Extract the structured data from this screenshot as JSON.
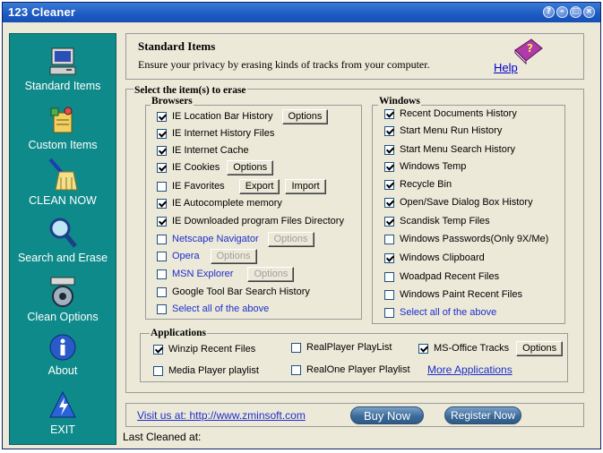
{
  "window": {
    "title": "123 Cleaner",
    "buttons": [
      "?",
      "–",
      "□",
      "×"
    ]
  },
  "sidebar": {
    "items": [
      {
        "label": "Standard Items",
        "icon": "computer-icon"
      },
      {
        "label": "Custom Items",
        "icon": "custom-items-icon"
      },
      {
        "label": "CLEAN NOW",
        "icon": "broom-icon"
      },
      {
        "label": "Search and  Erase",
        "icon": "magnifier-icon"
      },
      {
        "label": "Clean Options",
        "icon": "clean-options-icon"
      },
      {
        "label": "About",
        "icon": "info-icon"
      },
      {
        "label": "EXIT",
        "icon": "exit-icon"
      }
    ]
  },
  "header": {
    "title": "Standard Items",
    "description": "Ensure your privacy by erasing kinds of tracks from your computer.",
    "help": "Help"
  },
  "select_section": {
    "title": "Select the item(s) to erase"
  },
  "browsers": {
    "title": "Browsers",
    "items": [
      {
        "label": "IE Location Bar History",
        "checked": true,
        "buttons": [
          "Options"
        ]
      },
      {
        "label": "IE Internet History Files",
        "checked": true
      },
      {
        "label": "IE Internet Cache",
        "checked": true
      },
      {
        "label": "IE Cookies",
        "checked": true,
        "buttons": [
          "Options"
        ]
      },
      {
        "label": "IE Favorites",
        "checked": false,
        "buttons": [
          "Export",
          "Import"
        ]
      },
      {
        "label": "IE Autocomplete memory",
        "checked": true
      },
      {
        "label": "IE Downloaded program Files Directory",
        "checked": true
      },
      {
        "label": "Netscape Navigator",
        "checked": false,
        "buttons": [
          "Options"
        ]
      },
      {
        "label": "Opera",
        "checked": false,
        "buttons": [
          "Options"
        ]
      },
      {
        "label": "MSN Explorer",
        "checked": false,
        "buttons": [
          "Options"
        ]
      },
      {
        "label": "Google Tool Bar Search History",
        "checked": false
      },
      {
        "label": "Select all of the above",
        "checked": false
      }
    ]
  },
  "windows": {
    "title": "Windows",
    "items": [
      {
        "label": "Recent Documents History",
        "checked": true
      },
      {
        "label": "Start Menu Run History",
        "checked": true
      },
      {
        "label": "Start Menu Search History",
        "checked": true
      },
      {
        "label": "Windows Temp",
        "checked": true
      },
      {
        "label": "Recycle Bin",
        "checked": true
      },
      {
        "label": "Open/Save Dialog Box History",
        "checked": true
      },
      {
        "label": "Scandisk Temp Files",
        "checked": true
      },
      {
        "label": "Windows Passwords(Only 9X/Me)",
        "checked": false
      },
      {
        "label": "Windows Clipboard",
        "checked": true
      },
      {
        "label": "Woadpad Recent Files",
        "checked": false
      },
      {
        "label": "Windows Paint Recent Files",
        "checked": false
      },
      {
        "label": "Select all of the above",
        "checked": false
      }
    ]
  },
  "applications": {
    "title": "Applications",
    "items": [
      {
        "label": "Winzip Recent Files",
        "checked": true
      },
      {
        "label": "RealPlayer PlayList",
        "checked": false
      },
      {
        "label": "MS-Office Tracks",
        "checked": true,
        "button": "Options"
      },
      {
        "label": "Media Player playlist",
        "checked": false
      },
      {
        "label": "RealOne Player Playlist",
        "checked": false
      }
    ],
    "more": "More Applications"
  },
  "footer": {
    "visit": "Visit us at: http://www.zminsoft.com",
    "buy_now": "Buy Now",
    "register_now": "Register Now",
    "last_cleaned": "Last Cleaned at:"
  },
  "colors": {
    "sidebar": "#0f8a8a",
    "title_bar": "#1c5ac2",
    "link": "#1c2fcc",
    "window_bg": "#ece9d8"
  }
}
